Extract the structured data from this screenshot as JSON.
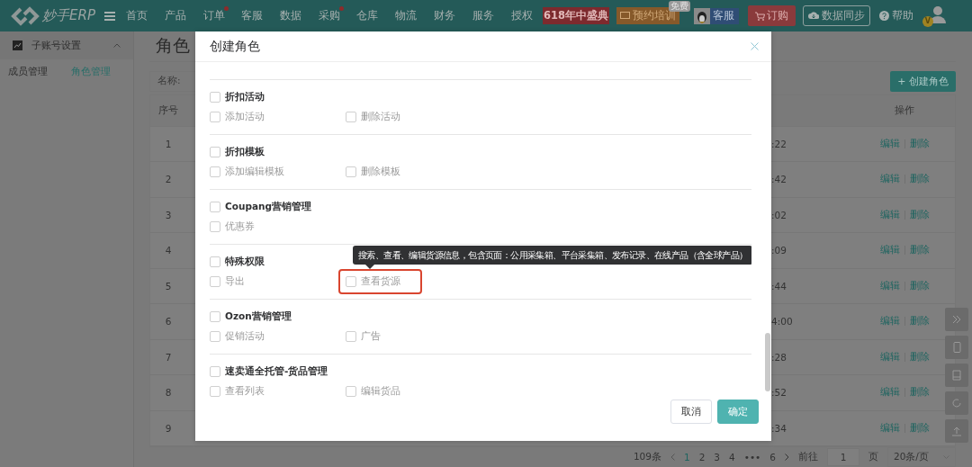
{
  "nav": {
    "logo_text": "妙手ERP",
    "items": [
      {
        "label": "首页",
        "dot": false
      },
      {
        "label": "产品",
        "dot": false
      },
      {
        "label": "订单",
        "dot": true
      },
      {
        "label": "客服",
        "dot": false
      },
      {
        "label": "数据",
        "dot": false
      },
      {
        "label": "采购",
        "dot": true
      },
      {
        "label": "仓库",
        "dot": false
      },
      {
        "label": "物流",
        "dot": false
      },
      {
        "label": "财务",
        "dot": false
      },
      {
        "label": "服务",
        "dot": false
      },
      {
        "label": "授权",
        "dot": false
      }
    ],
    "promo": "618年中盛典",
    "training": {
      "label": "预约培训",
      "badge": "免费"
    },
    "service": "客服",
    "order_button": "订购",
    "sync_button": "数据同步",
    "help": "帮助",
    "avatar_badge": "V"
  },
  "sidebar": {
    "group": {
      "label": "子账号设置",
      "expanded": true
    },
    "tabs": [
      {
        "label": "成员管理",
        "selected": false
      },
      {
        "label": "角色管理",
        "selected": true
      }
    ]
  },
  "page": {
    "title": "角色",
    "search": {
      "label": "名称:"
    },
    "create_button": "+ 创建角色",
    "table": {
      "columns": [
        "序号",
        "操作"
      ],
      "rows": [
        {
          "index": "1",
          "column_3": ":22",
          "actions": [
            "编辑",
            "删除"
          ]
        },
        {
          "index": "2",
          "column_3": ":42",
          "actions": [
            "编辑",
            "删除"
          ]
        },
        {
          "index": "3",
          "column_3": ":02",
          "actions": [
            "编辑",
            "删除"
          ]
        },
        {
          "index": "4",
          "column_3": ":09",
          "actions": [
            "编辑",
            "删除"
          ]
        },
        {
          "index": "5",
          "column_3": ":44",
          "actions": [
            "编辑",
            "删除"
          ]
        },
        {
          "index": "6",
          "column_3": "4:00",
          "actions": [
            "编辑",
            "删除"
          ]
        },
        {
          "index": "7",
          "column_3": ":28",
          "actions": [
            "编辑",
            "删除"
          ]
        },
        {
          "index": "8",
          "column_3": ":52",
          "actions": [
            "编辑",
            "删除"
          ]
        },
        {
          "index": "9",
          "column_3": ":34",
          "actions": [
            "编辑",
            "删除"
          ]
        }
      ]
    },
    "pagination": {
      "total": "109条",
      "pages": [
        {
          "label": "1",
          "selected": true
        },
        {
          "label": "2",
          "selected": false
        },
        {
          "label": "3",
          "selected": false
        },
        {
          "label": "4",
          "selected": false
        },
        {
          "label": "•••",
          "selected": false
        },
        {
          "label": "6",
          "selected": false
        }
      ],
      "goto_label": "前往",
      "goto_value": "1",
      "page_unit": "页",
      "page_size": "20条/页"
    }
  },
  "modal": {
    "title": "创建角色",
    "sections": [
      {
        "title": "折扣活动",
        "checked": false,
        "permissions": [
          {
            "label": "添加活动",
            "checked": false,
            "highlighted": false
          },
          {
            "label": "删除活动",
            "checked": false,
            "highlighted": false
          }
        ]
      },
      {
        "title": "折扣模板",
        "checked": false,
        "permissions": [
          {
            "label": "添加编辑模板",
            "checked": false,
            "highlighted": false
          },
          {
            "label": "删除模板",
            "checked": false,
            "highlighted": false
          }
        ]
      },
      {
        "title": "Coupang营销管理",
        "checked": false,
        "permissions": [
          {
            "label": "优惠券",
            "checked": false,
            "highlighted": false
          }
        ]
      },
      {
        "title": "特殊权限",
        "checked": false,
        "permissions": [
          {
            "label": "导出",
            "checked": false,
            "highlighted": false
          },
          {
            "label": "查看货源",
            "checked": false,
            "highlighted": true,
            "tooltip": "搜索、查看、编辑货源信息，包含页面：公用采集箱、平台采集箱、发布记录、在线产品（含全球产品）"
          }
        ]
      },
      {
        "title": "Ozon营销管理",
        "checked": false,
        "permissions": [
          {
            "label": "促销活动",
            "checked": false,
            "highlighted": false
          },
          {
            "label": "广告",
            "checked": false,
            "highlighted": false
          }
        ]
      },
      {
        "title": "速卖通全托管-货品管理",
        "checked": false,
        "permissions": [
          {
            "label": "查看列表",
            "checked": false,
            "highlighted": false
          },
          {
            "label": "编辑货品",
            "checked": false,
            "highlighted": false
          }
        ]
      }
    ],
    "buttons": {
      "cancel": "取消",
      "confirm": "确定"
    }
  }
}
